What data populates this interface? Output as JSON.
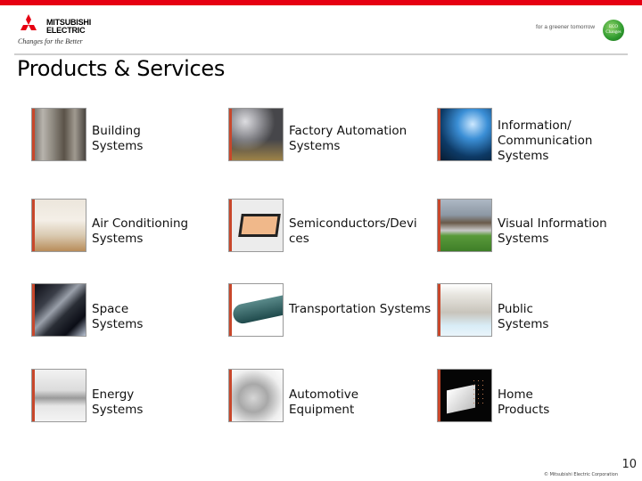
{
  "header": {
    "brand_line1": "MITSUBISHI",
    "brand_line2": "ELECTRIC",
    "tagline": "Changes for the Better",
    "slogan": "for a greener tomorrow",
    "eco_badge": "ECO Changes",
    "brand_color": "#e60012"
  },
  "page": {
    "title": "Products & Services",
    "page_number": "10",
    "copyright": "© Mitsubishi Electric Corporation"
  },
  "products": [
    {
      "label": "Building Systems",
      "icon": "elevator-photo"
    },
    {
      "label": "Factory Automation Systems",
      "icon": "robot-arm-photo"
    },
    {
      "label": "Information/ Communication Systems",
      "icon": "fiber-optics-photo"
    },
    {
      "label": "Air Conditioning Systems",
      "icon": "ceiling-ac-photo"
    },
    {
      "label": "Semiconductors/Devi ces",
      "icon": "chip-photo"
    },
    {
      "label": "Visual Information Systems",
      "icon": "stadium-screen-photo"
    },
    {
      "label": "Space Systems",
      "icon": "satellite-photo"
    },
    {
      "label": "Transportation Systems",
      "icon": "train-photo"
    },
    {
      "label": "Public Systems",
      "icon": "water-plant-photo"
    },
    {
      "label": "Energy Systems",
      "icon": "generator-photo"
    },
    {
      "label": "Automotive Equipment",
      "icon": "car-photo"
    },
    {
      "label": "Home Products",
      "icon": "house-photo"
    }
  ]
}
